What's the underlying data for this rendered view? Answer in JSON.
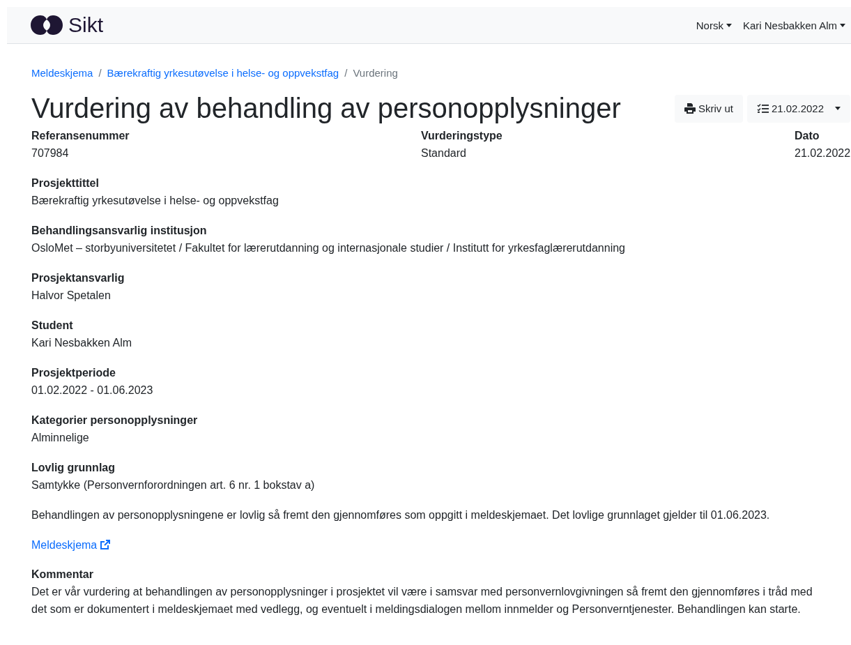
{
  "navbar": {
    "logo_text": "Sikt",
    "menus": [
      {
        "label": "Norsk"
      },
      {
        "label": "Kari Nesbakken Alm"
      }
    ]
  },
  "breadcrumb": [
    {
      "label": "Meldeskjema",
      "current": false
    },
    {
      "label": "Bærekraftig yrkesutøvelse i helse- og oppvekstfag",
      "current": false
    },
    {
      "label": "Vurdering",
      "current": true
    }
  ],
  "separator": "/",
  "title": "Vurdering av behandling av personopplysninger",
  "actions": {
    "print": "Skriv ut",
    "version": "21.02.2022"
  },
  "summary": [
    {
      "label": "Referansenummer",
      "value": "707984"
    },
    {
      "label": "Vurderingstype",
      "value": "Standard"
    },
    {
      "label": "Dato",
      "value": "21.02.2022"
    }
  ],
  "fields": [
    {
      "label": "Prosjekttittel",
      "value": "Bærekraftig yrkesutøvelse i helse- og oppvekstfag"
    },
    {
      "label": "Behandlingsansvarlig institusjon",
      "value": "OsloMet – storbyuniversitetet / Fakultet for lærerutdanning og internasjonale studier / Institutt for yrkesfaglærerutdanning"
    },
    {
      "label": "Prosjektansvarlig",
      "value": "Halvor Spetalen"
    },
    {
      "label": "Student",
      "value": "Kari Nesbakken Alm"
    },
    {
      "label": "Prosjektperiode",
      "value": "01.02.2022 - 01.06.2023"
    },
    {
      "label": "Kategorier personopplysninger",
      "value": "Alminnelige"
    },
    {
      "label": "Lovlig grunnlag",
      "value": "Samtykke (Personvernforordningen art. 6 nr. 1 bokstav a)"
    }
  ],
  "legal_note": "Behandlingen av personopplysningene er lovlig så fremt den gjennomføres som oppgitt i meldeskjemaet. Det lovlige grunnlaget gjelder til 01.06.2023.",
  "form_link": "Meldeskjema",
  "comment": {
    "label": "Kommentar",
    "text": "Det er vår vurdering at behandlingen av personopplysninger i prosjektet vil være i samsvar med personvernlovgivningen så fremt den gjennomføres i tråd med det som er dokumentert i meldeskjemaet med vedlegg, og eventuelt i meldingsdialogen mellom innmelder og Personverntjenester. Behandlingen kan starte."
  }
}
